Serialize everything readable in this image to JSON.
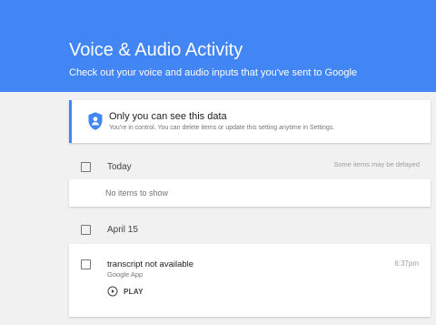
{
  "header": {
    "title": "Voice & Audio Activity",
    "subtitle": "Check out your voice and audio inputs that you've sent to Google",
    "background_color": "#4285f4"
  },
  "privacy_notice": {
    "icon": "shield-person-icon",
    "title": "Only you can see this data",
    "description": "You're in control. You can delete items or update this setting anytime in Settings."
  },
  "days": [
    {
      "label": "Today",
      "note": "Some items may be delayed",
      "empty_text": "No items to show"
    },
    {
      "label": "April 15",
      "items": [
        {
          "title": "transcript not available",
          "source": "Google App",
          "time": "6:37pm",
          "play_label": "PLAY",
          "play_icon": "play-circle-icon"
        }
      ]
    }
  ]
}
